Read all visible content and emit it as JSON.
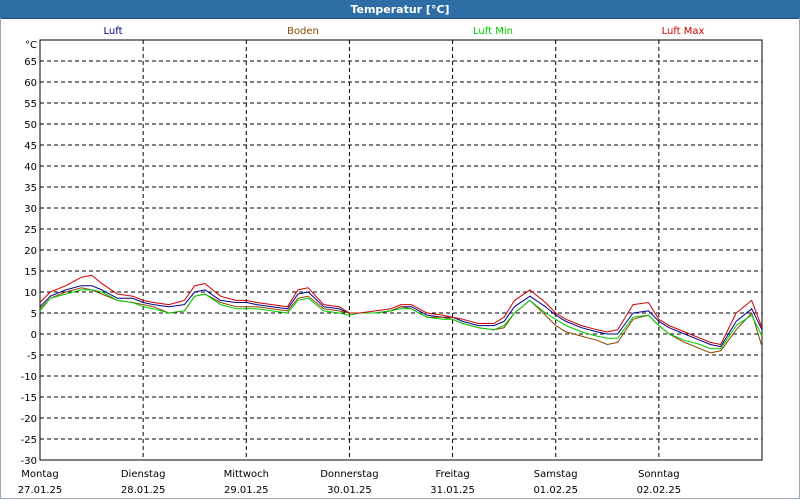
{
  "window": {
    "title": "Temperatur [°C]"
  },
  "chart_data": {
    "type": "line",
    "title": "Temperatur [°C]",
    "ylabel": "°C",
    "xlabel": "",
    "ylim": [
      -30,
      70
    ],
    "yticks": [
      65,
      60,
      55,
      50,
      45,
      40,
      35,
      30,
      25,
      20,
      15,
      10,
      5,
      0,
      -5,
      -10,
      -15,
      -20,
      -25,
      -30
    ],
    "grid": true,
    "legend_position": "top",
    "xlim": [
      0,
      7
    ],
    "x_categories": [
      {
        "day": "Montag",
        "date": "27.01.25"
      },
      {
        "day": "Dienstag",
        "date": "28.01.25"
      },
      {
        "day": "Mittwoch",
        "date": "29.01.25"
      },
      {
        "day": "Donnerstag",
        "date": "30.01.25"
      },
      {
        "day": "Freitag",
        "date": "31.01.25"
      },
      {
        "day": "Samstag",
        "date": "01.02.25"
      },
      {
        "day": "Sonntag",
        "date": "02.02.25"
      }
    ],
    "x": [
      0,
      0.1,
      0.25,
      0.4,
      0.5,
      0.6,
      0.75,
      0.9,
      1.0,
      1.1,
      1.25,
      1.4,
      1.5,
      1.6,
      1.75,
      1.9,
      2.0,
      2.1,
      2.25,
      2.4,
      2.5,
      2.6,
      2.75,
      2.9,
      3.0,
      3.1,
      3.25,
      3.4,
      3.5,
      3.6,
      3.75,
      3.9,
      4.0,
      4.1,
      4.25,
      4.4,
      4.5,
      4.6,
      4.75,
      4.9,
      5.0,
      5.1,
      5.25,
      5.4,
      5.5,
      5.6,
      5.75,
      5.9,
      6.0,
      6.1,
      6.25,
      6.4,
      6.5,
      6.6,
      6.75,
      6.9,
      7.0
    ],
    "series": [
      {
        "name": "Luft",
        "color": "#00008b",
        "values": [
          6.5,
          9,
          10.5,
          11.5,
          11.5,
          10.5,
          8.5,
          8.5,
          7.5,
          7,
          6.5,
          7,
          10,
          10.5,
          8,
          7.5,
          7.5,
          7,
          6.5,
          6,
          9.5,
          10,
          6.5,
          6,
          5,
          5,
          5,
          5.5,
          6.5,
          6.5,
          4.5,
          4,
          4,
          3,
          2,
          2,
          3,
          6.5,
          9,
          6.5,
          4.5,
          3,
          1.5,
          0.5,
          0,
          0,
          5,
          5.5,
          3,
          1.5,
          0,
          -1.5,
          -2.5,
          -3,
          3,
          6,
          1
        ]
      },
      {
        "name": "Boden",
        "color": "#8b4500",
        "values": [
          6,
          8.5,
          10,
          11,
          10.5,
          9.5,
          8,
          7.5,
          7,
          6.5,
          5,
          5.5,
          9,
          9.5,
          7.5,
          6.5,
          6.5,
          6.5,
          6,
          5.5,
          8.5,
          9,
          6,
          5.5,
          5,
          5,
          5,
          5.5,
          6.5,
          6,
          4,
          4,
          3.5,
          2.5,
          1.5,
          1,
          1.5,
          5,
          8,
          4.5,
          2,
          0.5,
          -0.5,
          -1.5,
          -2.5,
          -2,
          3.5,
          4.5,
          2,
          0,
          -2,
          -3.5,
          -4.5,
          -4,
          1,
          5,
          -3
        ]
      },
      {
        "name": "Luft Min",
        "color": "#00cc00",
        "values": [
          5.5,
          8.5,
          9.5,
          10.5,
          10.5,
          10,
          8,
          7.5,
          6.5,
          6,
          5,
          5.5,
          9,
          9.5,
          7,
          6,
          6,
          6,
          5.5,
          5,
          8,
          8.5,
          5.5,
          5,
          4.5,
          5,
          5,
          5.5,
          6,
          6,
          4,
          3.5,
          3.5,
          2.5,
          1.5,
          1,
          2,
          5,
          8,
          5,
          3.5,
          2,
          0.5,
          -0.5,
          -1,
          -1,
          4,
          4.5,
          2,
          0,
          -1.5,
          -2.5,
          -3.5,
          -3.5,
          2,
          4.5,
          -0.5
        ]
      },
      {
        "name": "Luft Max",
        "color": "#cc0000",
        "values": [
          7.5,
          10,
          11.5,
          13.5,
          14,
          12,
          9.5,
          9,
          8,
          7.5,
          7,
          8,
          11.5,
          12,
          9,
          8,
          8,
          7.5,
          7,
          6.5,
          10.5,
          11,
          7,
          6.5,
          5,
          5,
          5.5,
          6,
          7,
          7,
          5,
          4.5,
          4,
          3.5,
          2.5,
          2.5,
          4,
          8,
          10.5,
          7.5,
          5,
          3.5,
          2,
          1,
          0.5,
          1,
          7,
          7.5,
          3.5,
          2,
          0.5,
          -1,
          -2,
          -2.5,
          5,
          8,
          1.5
        ]
      }
    ]
  }
}
